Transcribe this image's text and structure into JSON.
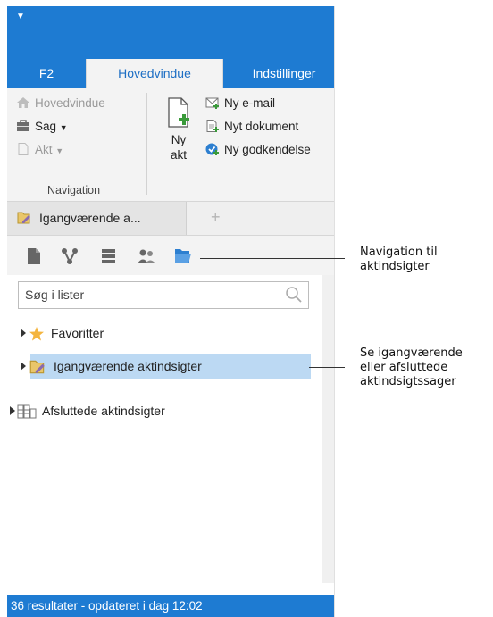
{
  "tabs": [
    {
      "label": "F2"
    },
    {
      "label": "Hovedvindue"
    },
    {
      "label": "Indstillinger"
    }
  ],
  "ribbon": {
    "nav_items": [
      "Hovedvindue",
      "Sag",
      "Akt"
    ],
    "group_label": "Navigation",
    "new_akt_label_1": "Ny",
    "new_akt_label_2": "akt",
    "new_items": [
      "Ny e-mail",
      "Nyt dokument",
      "Ny godkendelse"
    ]
  },
  "doc_tab": {
    "label": "Igangværende a..."
  },
  "search": {
    "placeholder": "Søg i lister"
  },
  "tree": [
    {
      "label": "Favoritter"
    },
    {
      "label": "Igangværende aktindsigter"
    },
    {
      "label": "Afsluttede aktindsigter"
    }
  ],
  "status": {
    "text": "36 resultater - opdateret i dag 12:02"
  },
  "callouts": {
    "nav_1": "Navigation til",
    "nav_2": "aktindsigter",
    "see_1": "Se igangværende",
    "see_2": "eller afsluttede",
    "see_3": "aktindsigtssager"
  },
  "colors": {
    "accent": "#1e7bd2",
    "selection": "#bcd9f3"
  }
}
